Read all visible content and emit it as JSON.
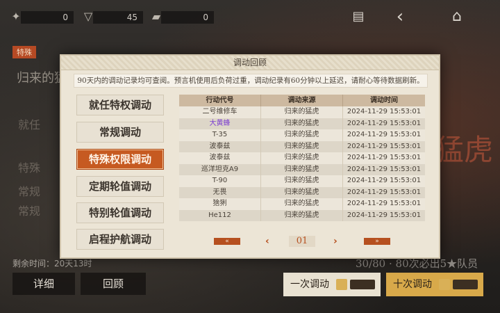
{
  "topbar": {
    "resources": [
      {
        "value": "0",
        "icon": "winged-emblem-icon"
      },
      {
        "value": "45",
        "icon": "triangle-crystal-icon"
      },
      {
        "value": "0",
        "icon": "gold-bar-icon"
      }
    ],
    "buttons": [
      {
        "icon": "clipboard-icon",
        "glyph": "▤"
      },
      {
        "icon": "back-arrow-icon",
        "glyph": "‹"
      },
      {
        "icon": "home-icon",
        "glyph": "⌂"
      }
    ]
  },
  "background": {
    "tag": "特殊",
    "banner_title": "归来的猛",
    "side_rows": [
      "就任",
      "特殊",
      "常规",
      "常规"
    ],
    "remaining_label": "剩余时间：20天13时",
    "detail_button": "详细",
    "review_button": "回顾",
    "progress": "30/80 · 80次必出5★队员",
    "single_pull": "一次调动",
    "ten_pull": "十次调动",
    "banner_art_text": "猛虎"
  },
  "modal": {
    "title": "调动回顾",
    "notice": "90天内的调动记录均可查阅。预言机使用后负荷过重，调动纪录有60分钟以上延迟，请耐心等待数据刷新。",
    "tabs": [
      {
        "label": "就任特权调动",
        "active": false
      },
      {
        "label": "常规调动",
        "active": false
      },
      {
        "label": "特殊权限调动",
        "active": true
      },
      {
        "label": "定期轮值调动",
        "active": false
      },
      {
        "label": "特别轮值调动",
        "active": false
      },
      {
        "label": "启程护航调动",
        "active": false
      }
    ],
    "table": {
      "columns": [
        "行动代号",
        "调动来源",
        "调动时间"
      ],
      "rows": [
        {
          "name": "二号维修车",
          "source": "归来的猛虎",
          "time": "2024-11-29 15:53:01",
          "highlight": false
        },
        {
          "name": "大黄蜂",
          "source": "归来的猛虎",
          "time": "2024-11-29 15:53:01",
          "highlight": true
        },
        {
          "name": "T-35",
          "source": "归来的猛虎",
          "time": "2024-11-29 15:53:01",
          "highlight": false
        },
        {
          "name": "波泰兹",
          "source": "归来的猛虎",
          "time": "2024-11-29 15:53:01",
          "highlight": false
        },
        {
          "name": "波泰兹",
          "source": "归来的猛虎",
          "time": "2024-11-29 15:53:01",
          "highlight": false
        },
        {
          "name": "巡洋坦克A9",
          "source": "归来的猛虎",
          "time": "2024-11-29 15:53:01",
          "highlight": false
        },
        {
          "name": "T-90",
          "source": "归来的猛虎",
          "time": "2024-11-29 15:53:01",
          "highlight": false
        },
        {
          "name": "无畏",
          "source": "归来的猛虎",
          "time": "2024-11-29 15:53:01",
          "highlight": false
        },
        {
          "name": "猞猁",
          "source": "归来的猛虎",
          "time": "2024-11-29 15:53:01",
          "highlight": false
        },
        {
          "name": "He112",
          "source": "归来的猛虎",
          "time": "2024-11-29 15:53:01",
          "highlight": false
        }
      ]
    },
    "pager": {
      "first": "«",
      "prev": "‹",
      "page": "01",
      "next": "›",
      "last": "»"
    },
    "colors": {
      "accent": "#c65a21",
      "highlight_text": "#7a3cd0"
    }
  }
}
